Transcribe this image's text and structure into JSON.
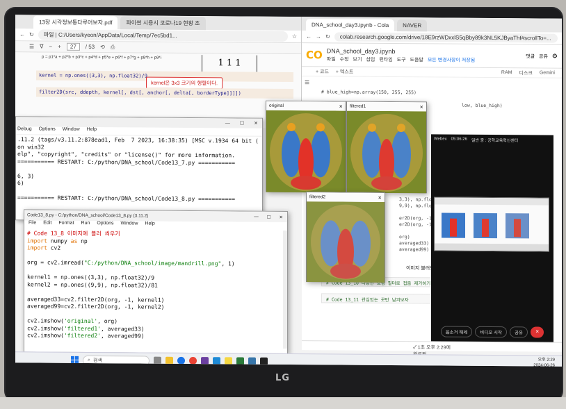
{
  "pdf": {
    "tab1": "13장 시각정보통다루어보자.pdf",
    "tab2": "파이썬 시용시 코로나19 현황 조",
    "address": "파일 | C:/Users/kyeon/AppData/Local/Temp/7ec5bd1...",
    "page_current": "27",
    "page_total": "/ 53",
    "formula": "p = p1*a + p2*b + p3*c + p4*d + p5*e + p6*f + p7*g + p8*h + p9*i",
    "matrix": "1 1 1",
    "code1": "kernel = np.ones((3,3), np.float32)/9",
    "tooltip": "kernel은 3x3 크기의 행렬이다.",
    "code2": "filter2D(src, ddepth, kernel[, dst[, anchor[, delta[, borderType]]]])"
  },
  "colab": {
    "tab1": "DNA_school_day3.ipynb - Cola",
    "tab2": "NAVER",
    "url": "colab.research.google.com/drive/18E9rzWDxxlS5qBby89k3NL5KJByaThf#scrollTo=...",
    "logo": "CO",
    "title": "DNA_school_day3.ipynb",
    "menu": [
      "파일",
      "수정",
      "보기",
      "삽입",
      "런타임",
      "도구",
      "도움말"
    ],
    "saved": "모든 변경사항이 저장됨",
    "comment": "댓글",
    "share": "공유",
    "add_code": "+ 코드",
    "add_text": "+ 텍스트",
    "ram": "RAM",
    "disk": "디스크",
    "gemini": "Gemini",
    "line1": "# blue_high=np.array(150, 255, 255)",
    "line2": "low, blue_high)",
    "line3": "3,3), np.float32)/9",
    "line4": "9,9), np.float32)/81",
    "line5": "er2D(org, -1, kerne",
    "line6": "er2D(org, -1, kerne",
    "line7": "org)",
    "line8": "averaged33)",
    "line9": "averaged99)",
    "section": "이미지 블러링하기",
    "cell_a": "# Code 13_10 다양한 흐림 필터로 접음 제거하기",
    "cell_b": "# Code 13_11 관심있는 곳만 남겨보자",
    "status_check": "✓ 1초",
    "status_time": "오후 2:29에 완료됨"
  },
  "shell": {
    "menu": [
      "Debug",
      "Options",
      "Window",
      "Help"
    ],
    "lines": [
      ".11.2 (tags/v3.11.2:878ead1, Feb  7 2023, 16:38:35) [MSC v.1934 64 bit (",
      "on win32",
      "elp\", \"copyright\", \"credits\" or \"license()\" for more information.",
      "=========== RESTART: C:/python/DNA_school/Code13_7.py ===========",
      "",
      "6, 3)",
      "6)",
      "",
      "=========== RESTART: C:/python/DNA_school/Code13_8.py ==========="
    ]
  },
  "editor": {
    "title": "Code13_8.py - C:/python/DNA_school/Code13_8.py (3.11.2)",
    "menu": [
      "File",
      "Edit",
      "Format",
      "Run",
      "Options",
      "Window",
      "Help"
    ],
    "comment": "# Code 13_8 이미지에 블러 씌우기",
    "imp1a": "import",
    "imp1b": " numpy ",
    "imp1c": "as",
    "imp1d": " np",
    "imp2a": "import",
    "imp2b": " cv2",
    "l_org_a": "org = cv2.imread(",
    "l_org_b": "\"C:/python/DNA_school/image/mandrill.png\"",
    "l_org_c": ", 1)",
    "l_k1": "kernel1 = np.ones((3,3), np.float32)/9",
    "l_k2": "kernel2 = np.ones((9,9), np.float32)/81",
    "l_a33": "averaged33=cv2.filter2D(org, -1, kernel1)",
    "l_a99": "averaged99=cv2.filter2D(org, -1, kernel2)",
    "s1a": "cv2.imshow(",
    "s1b": "'original'",
    "s1c": ", org)",
    "s2a": "cv2.imshow(",
    "s2b": "'filtered1'",
    "s2c": ", averaged33)",
    "s3a": "cv2.imshow(",
    "s3b": "'filtered2'",
    "s3c": ", averaged99)"
  },
  "images": {
    "original": "original",
    "filtered1": "filtered1",
    "filtered2": "filtered2"
  },
  "webex": {
    "app": "Webex",
    "time": "05:06:26",
    "info": "일반 중 : 공학교육혁신센터",
    "mute": "음소거 해제",
    "video": "비디오 시작",
    "share": "공유"
  },
  "taskbar": {
    "search": "검색",
    "time": "오후 2:29",
    "date": "2024-06-26"
  },
  "brand": "LG"
}
